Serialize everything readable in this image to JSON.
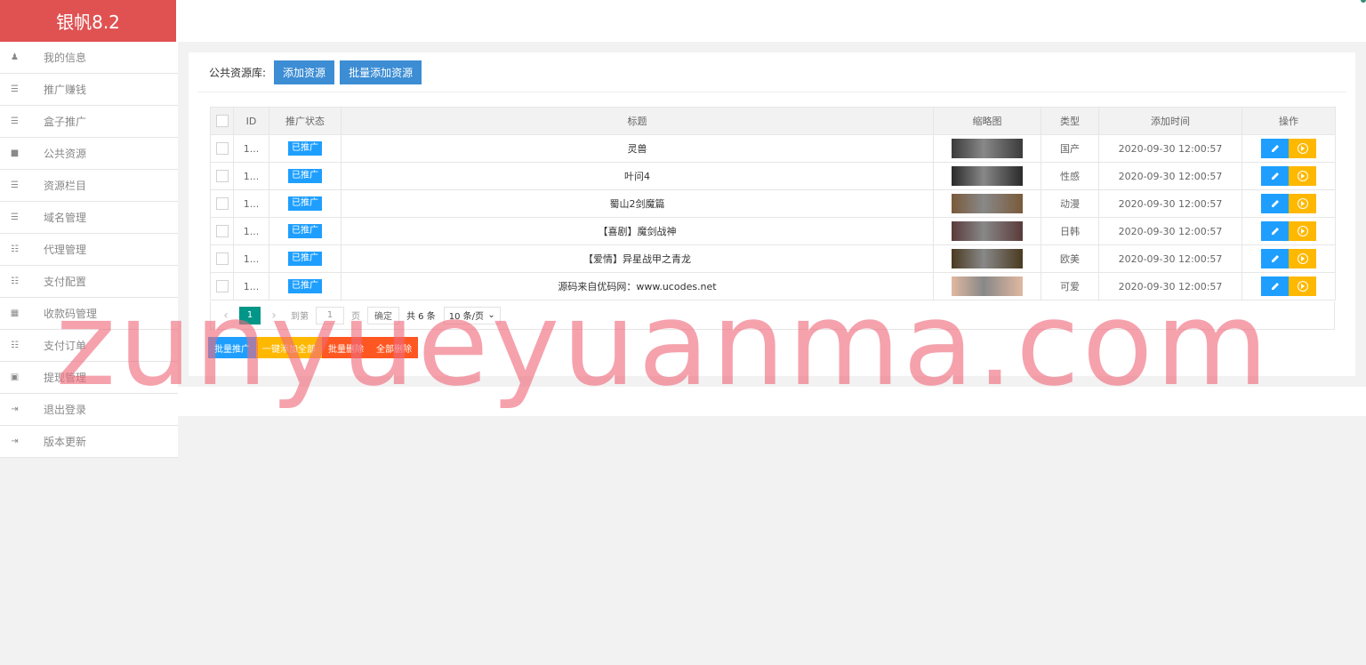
{
  "app": {
    "title": "银帆8.2"
  },
  "sidebar": {
    "items": [
      {
        "label": "我的信息",
        "icon": "user-icon",
        "glyph": "♟"
      },
      {
        "label": "推广赚钱",
        "icon": "list-icon",
        "glyph": "☰"
      },
      {
        "label": "盒子推广",
        "icon": "list-icon",
        "glyph": "☰"
      },
      {
        "label": "公共资源",
        "icon": "video-icon",
        "glyph": "■"
      },
      {
        "label": "资源栏目",
        "icon": "list-icon",
        "glyph": "☰"
      },
      {
        "label": "域名管理",
        "icon": "list-icon",
        "glyph": "☰"
      },
      {
        "label": "代理管理",
        "icon": "list-ul-icon",
        "glyph": "☷"
      },
      {
        "label": "支付配置",
        "icon": "list-ul-icon",
        "glyph": "☷"
      },
      {
        "label": "收款码管理",
        "icon": "qrcode-icon",
        "glyph": "▦"
      },
      {
        "label": "支付订单",
        "icon": "list-ul-icon",
        "glyph": "☷"
      },
      {
        "label": "提现管理",
        "icon": "money-icon",
        "glyph": "▣"
      },
      {
        "label": "退出登录",
        "icon": "sign-in-icon",
        "glyph": "⇥"
      },
      {
        "label": "版本更新",
        "icon": "sign-in-icon",
        "glyph": "⇥"
      }
    ]
  },
  "toolbar": {
    "caption": "公共资源库:",
    "add_label": "添加资源",
    "bulk_add_label": "批量添加资源"
  },
  "table": {
    "headers": [
      "ID",
      "推广状态",
      "标题",
      "缩略图",
      "类型",
      "添加时间",
      "操作"
    ],
    "rows": [
      {
        "id": "1...",
        "status": "已推广",
        "title": "灵兽",
        "type": "国产",
        "time": "2020-09-30 12:00:57",
        "thumb": "#3b3b3b"
      },
      {
        "id": "1...",
        "status": "已推广",
        "title": "叶问4",
        "type": "性感",
        "time": "2020-09-30 12:00:57",
        "thumb": "#2a2a2a"
      },
      {
        "id": "1...",
        "status": "已推广",
        "title": "蜀山2剑魔篇",
        "type": "动漫",
        "time": "2020-09-30 12:00:57",
        "thumb": "#7a5a3a"
      },
      {
        "id": "1...",
        "status": "已推广",
        "title": "【喜剧】魔剑战神",
        "type": "日韩",
        "time": "2020-09-30 12:00:57",
        "thumb": "#5a3a3a"
      },
      {
        "id": "1...",
        "status": "已推广",
        "title": "【爱情】异星战甲之青龙",
        "type": "欧美",
        "time": "2020-09-30 12:00:57",
        "thumb": "#4a3a20"
      },
      {
        "id": "1...",
        "status": "已推广",
        "title": "源码来自优码网：www.ucodes.net",
        "type": "可爱",
        "time": "2020-09-30 12:00:57",
        "thumb": "#e0b8a0"
      }
    ]
  },
  "pager": {
    "current": "1",
    "goto_label": "到第",
    "goto_value": "1",
    "page_label": "页",
    "confirm_label": "确定",
    "total_label": "共 6 条",
    "page_size": "10 条/页"
  },
  "bulk": {
    "promote": "批量推广",
    "add_all": "一键添加全部",
    "bulk_delete": "批量删除",
    "delete_all": "全部删除"
  },
  "watermark": "zunyueyuanma.com",
  "colors": {
    "brand": "#e05252",
    "primary": "#3c8dd4",
    "blue": "#1e9fff",
    "yellow": "#ffb800",
    "green": "#009688",
    "red": "#ff5722"
  }
}
